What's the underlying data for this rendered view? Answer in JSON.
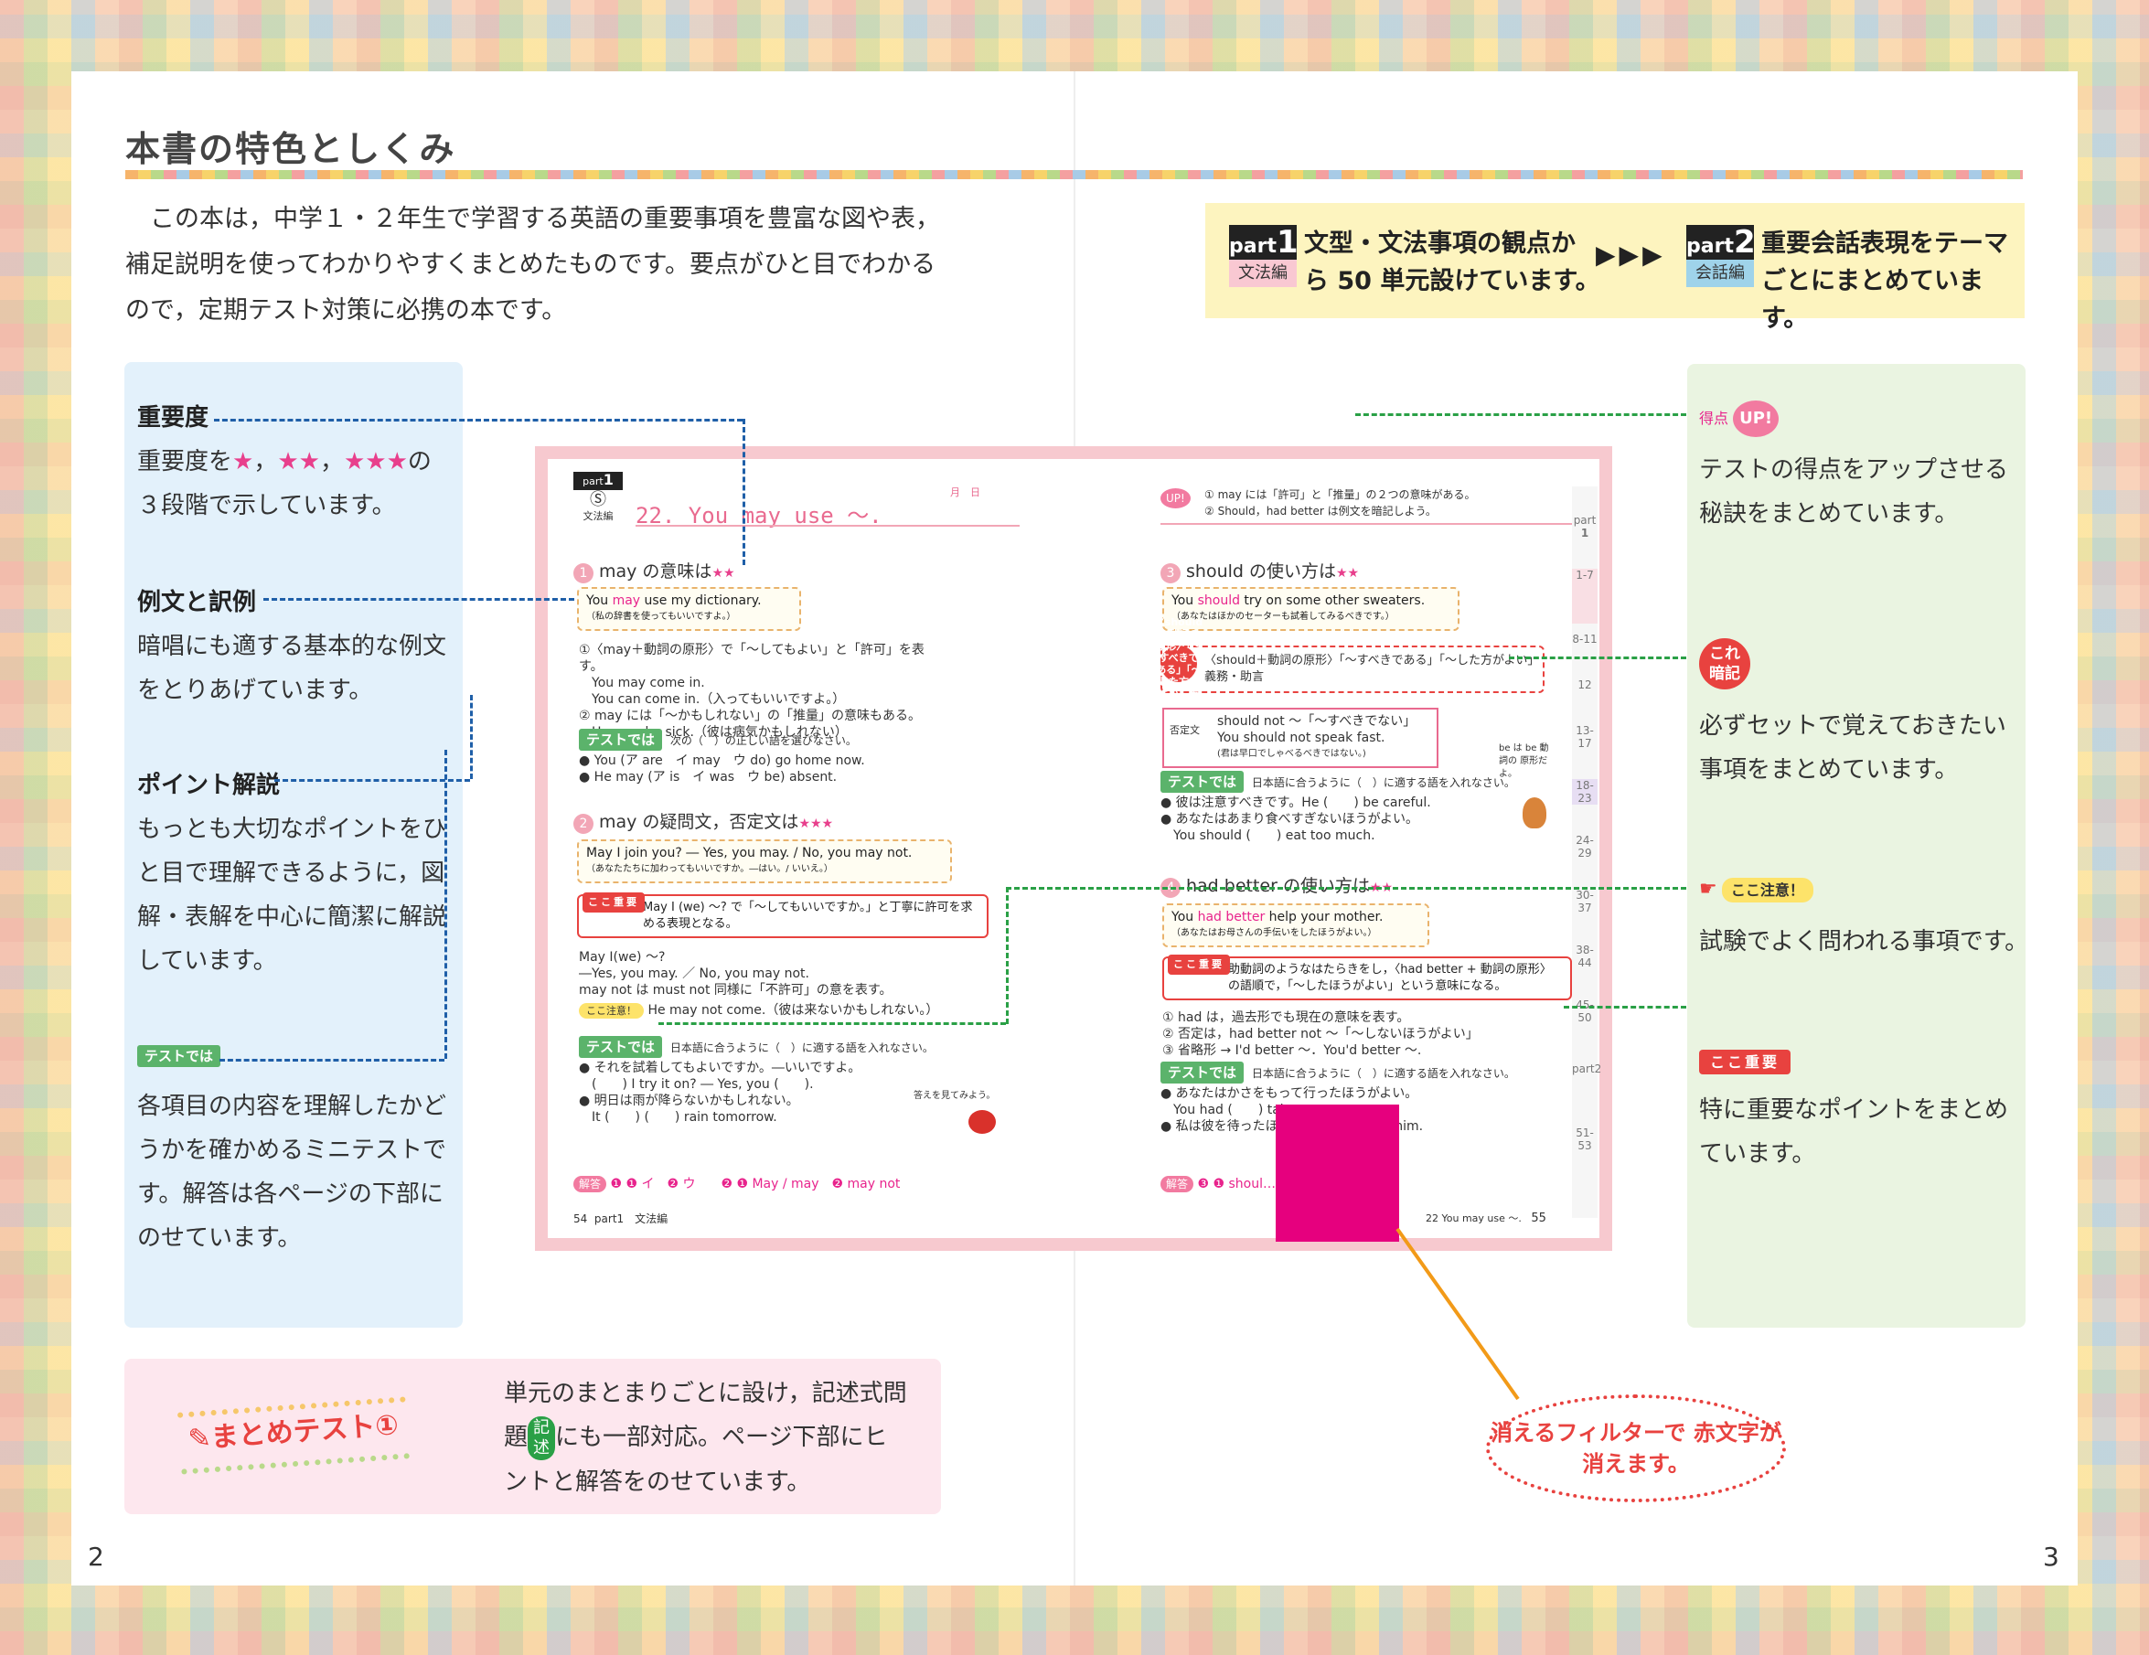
{
  "title": "本書の特色としくみ",
  "intro": "この本は，中学１・２年生で学習する英語の重要事項を豊富な図や表，補足説明を使ってわかりやすくまとめたものです。要点がひと目でわかるので，定期テスト対策に必携の本です。",
  "parts": {
    "part1": {
      "label": "part",
      "num": "1",
      "cat": "文法編",
      "line1": "文型・文法事項の観点か",
      "line2": "ら 50 単元設けています。"
    },
    "arrows": "▶▶▶",
    "part2": {
      "label": "part",
      "num": "2",
      "cat": "会話編",
      "line1": "重要会話表現をテーマ",
      "line2": "ごとにまとめています。"
    }
  },
  "left_panel": {
    "importance": {
      "head": "重要度",
      "body_pre": "重要度を",
      "s1": "★",
      "s2": "★★",
      "s3": "★★★",
      "body_post": "の",
      "line2": "３段階で示しています。"
    },
    "examples": {
      "head": "例文と訳例",
      "line1": "暗唱にも適する基本的な例文",
      "line2": "をとりあげています。"
    },
    "point": {
      "head": "ポイント解説",
      "line1": "もっとも大切なポイントをひ",
      "line2": "と目で理解できるように，図",
      "line3": "解・表解を中心に簡潔に解説",
      "line4": "しています。"
    },
    "test": {
      "tag": "テストでは",
      "line1": "各項目の内容を理解したかど",
      "line2": "うかを確かめるミニテストで",
      "line3": "す。解答は各ページの下部に",
      "line4": "のせています。"
    }
  },
  "right_panel": {
    "up": {
      "tag_pre": "得点",
      "tag": "UP!",
      "line1": "テストの得点をアップさせる",
      "line2": "秘訣をまとめています。"
    },
    "kore": {
      "tag": "これ 暗記",
      "line1": "必ずセットで覚えておきたい",
      "line2": "事項をまとめています。"
    },
    "chui": {
      "tag": "ここ注意！",
      "line1": "試験でよく問われる事項です。"
    },
    "juyo": {
      "tag": "ここ重要",
      "line1": "特に重要なポイントをまとめ",
      "line2": "ています。"
    }
  },
  "book": {
    "part_label": "part",
    "part_num": "1",
    "part_cat": "文法編",
    "unit_title": "22.  You  may  use 〜.",
    "date": "月　日",
    "up_note1": "① may には「許可」と「推量」の２つの意味がある。",
    "up_note2": "② Should，had better は例文を暗記しよう。",
    "sec1": {
      "num": "1",
      "title": "may の意味は",
      "stars": "★★"
    },
    "ex1": {
      "en_pre": "You ",
      "en_key": "may",
      "en_post": " use my dictionary.",
      "ja": "（私の辞書を使ってもいいですよ。）"
    },
    "p1_l1": "①〈may＋動詞の原形〉で「〜してもよい」と「許可」を表す。",
    "p1_l2": "You may come in.",
    "p1_l3": "You can come in.（入ってもいいですよ。）",
    "p1_l4": "② may には「〜かもしれない」の「推量」の意味もある。",
    "p1_l5": "He may be sick.（彼は病気かもしれない）",
    "test1_tag": "テストでは",
    "test1_q": "次の（　）の正しい語を選びなさい。",
    "test1_a": "● You (ア are　イ may　ウ do) go home now.",
    "test1_b": "● He may (ア is　イ was　ウ be) absent.",
    "sec2": {
      "num": "2",
      "title": "may の疑問文，否定文は",
      "stars": "★★★"
    },
    "ex2": {
      "en": "May I join you? ― Yes, you may. / No, you may not.",
      "ja": "（あなたたちに加わってもいいですか。―はい。/ いいえ。）"
    },
    "koko1_tag": "ここ重要",
    "koko1_text": "May I (we) 〜? で「〜してもいいですか。」と丁寧に許可を求める表現となる。",
    "p2_l1": "May I(we) 〜?",
    "p2_l2": "―Yes, you may. ／ No, you may not.",
    "p2_l3": "may not は must not 同様に「不許可」の意を表す。",
    "chui_tag": "ここ注意！",
    "chui_text": "He may not come.（彼は来ないかもしれない。）",
    "test2_tag": "テストでは",
    "test2_q": "日本語に合うように（　）に適する語を入れなさい。",
    "test2_a": "● それを試着してもよいですか。―いいですよ。",
    "test2_b": "(　　) I try it on? ― Yes, you (　　).",
    "test2_c": "● 明日は雨が降らないかもしれない。",
    "test2_d": "It (　　) (　　) rain tomorrow.",
    "note_small": "答えを見てみよう。",
    "ans_tag": "解答",
    "ans_left": "❶ ❶ イ　❷ ウ　　❷ ❶ May / may　❷ may not",
    "ans_right": "❸ ❶ shoul…　　…etter　❷ I'd",
    "pg_left": "54",
    "pg_left_label": "part1　文法編",
    "pg_right_label": "22  You may use 〜.",
    "pg_right": "55",
    "sec3": {
      "num": "3",
      "title": "should の使い方は",
      "stars": "★★"
    },
    "ex3": {
      "en_pre": "You ",
      "en_key": "should",
      "en_post": " try on some other sweaters.",
      "ja": "（あなたはほかのセーターも試着してみるべきです。）"
    },
    "kore_text": "〈should＋動詞の原形〉「〜すべきである」「〜した方がよい」義務・助言",
    "neg_tag": "否定文",
    "neg_l1": "should not 〜「〜すべきでない」",
    "neg_l2": "You should not speak fast.",
    "neg_l3": "(君は早口でしゃべるべきではない。)",
    "test3_tag": "テストでは",
    "test3_q": "日本語に合うように（　）に適する語を入れなさい。",
    "test3_a": "● 彼は注意すべきです。He (　　) be careful.",
    "test3_b": "● あなたはあまり食べすぎないほうがよい。",
    "test3_c": "You should (　　) eat too much.",
    "side_note": "be は be 動詞の 原形だよ。",
    "sec4": {
      "num": "4",
      "title": "had better の使い方は",
      "stars": "★★"
    },
    "ex4": {
      "en_pre": "You ",
      "en_key": "had better",
      "en_post": " help your mother.",
      "ja": "（あなたはお母さんの手伝いをしたほうがよい。）"
    },
    "koko2_tag": "ここ重要",
    "koko2_text": "助動詞のようなはたらきをし，〈had better + 動詞の原形〉の語順で，「〜したほうがよい」という意味になる。",
    "p4_l1": "① had は，過去形でも現在の意味を表す。",
    "p4_l2": "② 否定は，had better not 〜「〜しないほうがよい」",
    "p4_l3": "③ 省略形 → I'd better 〜．You'd better 〜.",
    "test4_tag": "テストでは",
    "test4_q": "日本語に合うように（　）に適する語を入れなさい。",
    "test4_a": "● あなたはかさをもって行ったほうがよい。",
    "test4_b": "You had (　　) tak…　　　　…u.",
    "test4_c": "● 私は彼を待ったほ…　　　…wait for him.",
    "side_tabs": [
      "1-7",
      "8-11",
      "12",
      "13-17",
      "18-23",
      "24-29",
      "30-37",
      "38-44",
      "45-50",
      "part2",
      "51-53"
    ]
  },
  "summary": {
    "badge": "まとめテスト①",
    "line1": "単元のまとまりごとに設け，記述式問",
    "line2_pre": "題",
    "kijutsu": "記述",
    "line2_post": "にも一部対応。ページ下部にヒ",
    "line3": "ントと解答をのせています。"
  },
  "filter_note": "消えるフィルターで 赤文字が消えます。",
  "page_left": "2",
  "page_right": "3"
}
